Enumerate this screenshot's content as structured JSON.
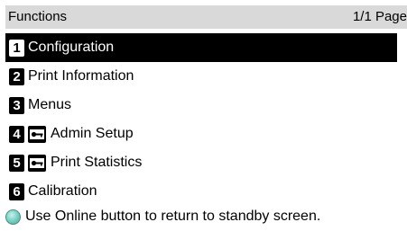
{
  "header": {
    "title": "Functions",
    "page_indicator": "1/1 Page"
  },
  "menu": {
    "items": [
      {
        "number": "1",
        "label": "Configuration",
        "locked": false,
        "selected": true
      },
      {
        "number": "2",
        "label": "Print Information",
        "locked": false,
        "selected": false
      },
      {
        "number": "3",
        "label": "Menus",
        "locked": false,
        "selected": false
      },
      {
        "number": "4",
        "label": "Admin Setup",
        "locked": true,
        "selected": false,
        "icon": "key-icon"
      },
      {
        "number": "5",
        "label": "Print Statistics",
        "locked": true,
        "selected": false,
        "icon": "key-icon"
      },
      {
        "number": "6",
        "label": "Calibration",
        "locked": false,
        "selected": false
      }
    ]
  },
  "footer": {
    "icon": "online-button-icon",
    "message": "Use Online button to return to standby screen."
  },
  "colors": {
    "header_bg": "#d9d9d9",
    "selected_bg": "#000000",
    "selected_text": "#ffffff",
    "online_icon": "#7fd3c7"
  }
}
